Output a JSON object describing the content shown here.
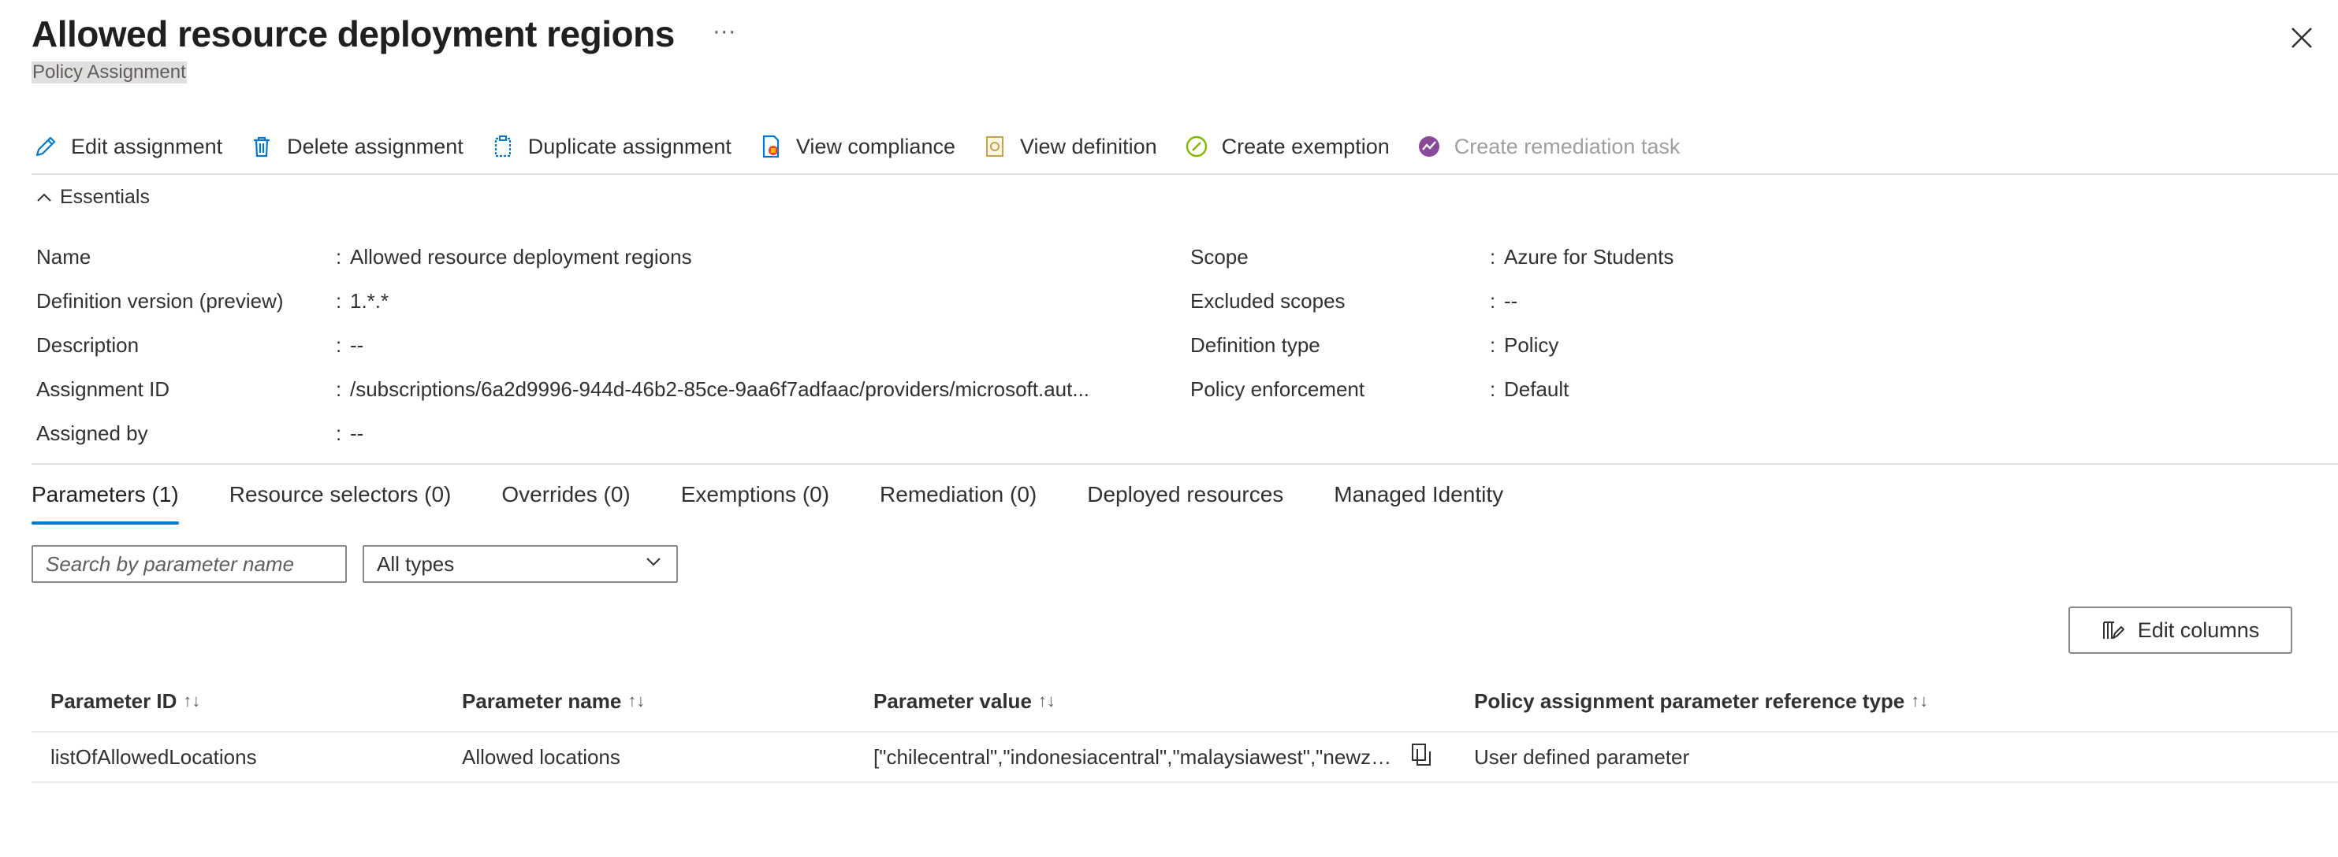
{
  "header": {
    "title": "Allowed resource deployment regions",
    "more_symbol": "···",
    "subtitle": "Policy Assignment"
  },
  "toolbar": {
    "edit": "Edit assignment",
    "delete": "Delete assignment",
    "duplicate": "Duplicate assignment",
    "view_compliance": "View compliance",
    "view_definition": "View definition",
    "create_exemption": "Create exemption",
    "create_remediation": "Create remediation task"
  },
  "essentials": {
    "toggle_label": "Essentials",
    "left": [
      {
        "label": "Name",
        "value": "Allowed resource deployment regions"
      },
      {
        "label": "Definition version (preview)",
        "value": "1.*.*"
      },
      {
        "label": "Description",
        "value": "--"
      },
      {
        "label": "Assignment ID",
        "value": "/subscriptions/6a2d9996-944d-46b2-85ce-9aa6f7adfaac/providers/microsoft.aut..."
      },
      {
        "label": "Assigned by",
        "value": "--"
      }
    ],
    "right": [
      {
        "label": "Scope",
        "value": "Azure for Students"
      },
      {
        "label": "Excluded scopes",
        "value": "--"
      },
      {
        "label": "Definition type",
        "value": "Policy"
      },
      {
        "label": "Policy enforcement",
        "value": "Default"
      }
    ],
    "colon": ":"
  },
  "tabs": [
    "Parameters (1)",
    "Resource selectors (0)",
    "Overrides (0)",
    "Exemptions (0)",
    "Remediation (0)",
    "Deployed resources",
    "Managed Identity"
  ],
  "filters": {
    "search_placeholder": "Search by parameter name",
    "type_selected": "All types"
  },
  "edit_columns_label": "Edit columns",
  "table": {
    "columns": [
      "Parameter ID",
      "Parameter name",
      "Parameter value",
      "Policy assignment parameter reference type"
    ],
    "sort_symbol": "↑↓",
    "rows": [
      {
        "id": "listOfAllowedLocations",
        "name": "Allowed locations",
        "value": "[\"chilecentral\",\"indonesiacentral\",\"malaysiawest\",\"newzea...",
        "ref_type": "User defined parameter"
      }
    ]
  },
  "colors": {
    "accent": "#0078d4",
    "text": "#323130",
    "disabled": "#a19f9d",
    "divider": "#e1dfdd"
  }
}
